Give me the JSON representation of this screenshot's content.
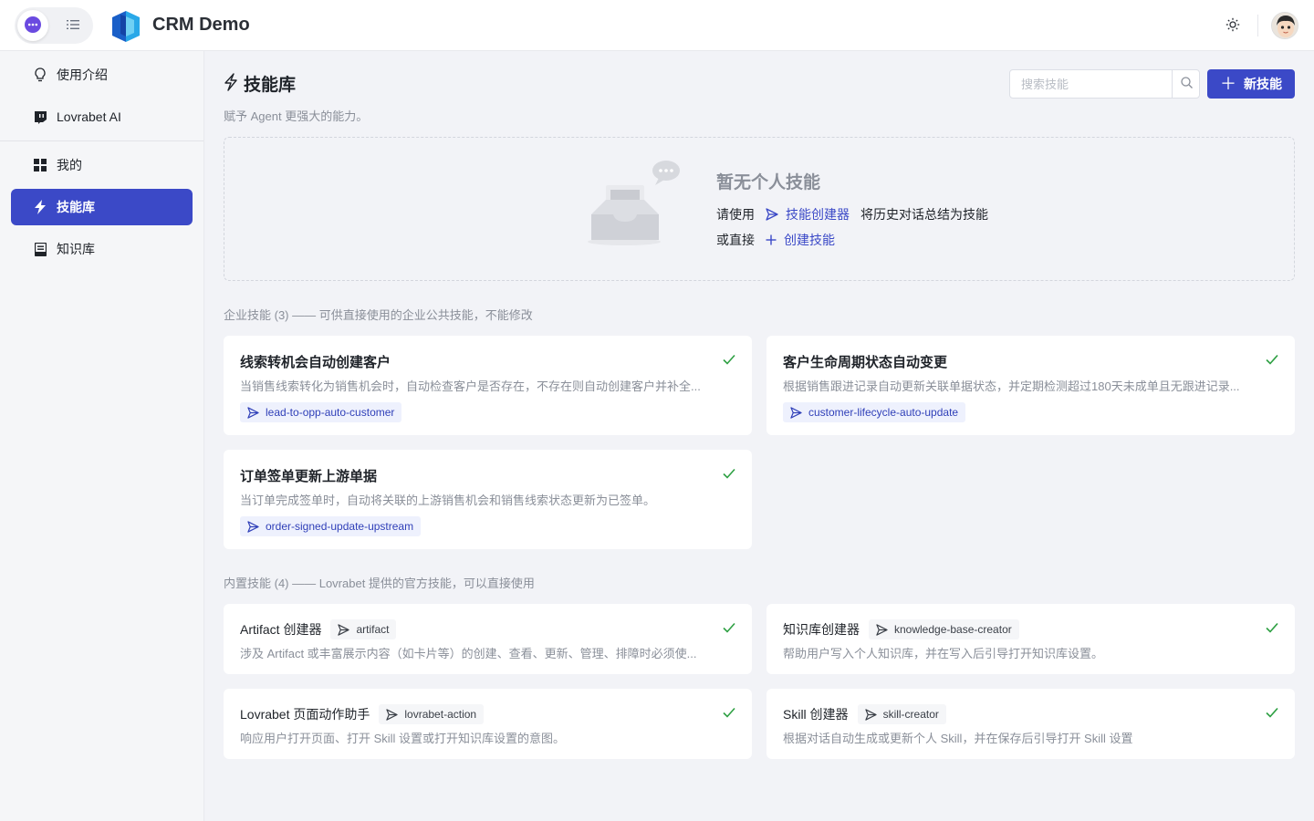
{
  "header": {
    "app_title": "CRM Demo",
    "icons": {
      "chat_toggle": "chat-bubble-icon",
      "list_toggle": "list-icon",
      "logo": "crm-logo-icon",
      "theme": "sun-icon",
      "avatar": "user-avatar"
    },
    "accent_color": "#3b49c7"
  },
  "sidebar": {
    "items": [
      {
        "label": "使用介绍",
        "icon": "lightbulb-icon"
      },
      {
        "label": "Lovrabet AI",
        "icon": "twitch-chat-icon"
      },
      {
        "label": "我的",
        "icon": "grid-icon"
      },
      {
        "label": "技能库",
        "icon": "bolt-icon",
        "active": true
      },
      {
        "label": "知识库",
        "icon": "book-icon"
      }
    ]
  },
  "main": {
    "title": "技能库",
    "subtitle": "赋予 Agent 更强大的能力。",
    "search": {
      "placeholder": "搜索技能"
    },
    "new_button": "新技能",
    "empty": {
      "title": "暂无个人技能",
      "line1_prefix": "请使用",
      "line1_link": "技能创建器",
      "line1_suffix": "将历史对话总结为技能",
      "line2_prefix": "或直接",
      "line2_link": "创建技能"
    },
    "enterprise_label": "企业技能 (3) —— 可供直接使用的企业公共技能，不能修改",
    "enterprise_skills": [
      {
        "title": "线索转机会自动创建客户",
        "desc": "当销售线索转化为销售机会时，自动检查客户是否存在，不存在则自动创建客户并补全...",
        "tag": "lead-to-opp-auto-customer"
      },
      {
        "title": "客户生命周期状态自动变更",
        "desc": "根据销售跟进记录自动更新关联单据状态，并定期检测超过180天未成单且无跟进记录...",
        "tag": "customer-lifecycle-auto-update"
      },
      {
        "title": "订单签单更新上游单据",
        "desc": "当订单完成签单时，自动将关联的上游销售机会和销售线索状态更新为已签单。",
        "tag": "order-signed-update-upstream"
      }
    ],
    "builtin_label": "内置技能 (4) —— Lovrabet 提供的官方技能，可以直接使用",
    "builtin_skills": [
      {
        "title": "Artifact 创建器",
        "tag": "artifact",
        "desc": "涉及 Artifact 或丰富展示内容（如卡片等）的创建、查看、更新、管理、排障时必须使..."
      },
      {
        "title": "知识库创建器",
        "tag": "knowledge-base-creator",
        "desc": "帮助用户写入个人知识库，并在写入后引导打开知识库设置。"
      },
      {
        "title": "Lovrabet 页面动作助手",
        "tag": "lovrabet-action",
        "desc": "响应用户打开页面、打开 Skill 设置或打开知识库设置的意图。"
      },
      {
        "title": "Skill 创建器",
        "tag": "skill-creator",
        "desc": "根据对话自动生成或更新个人 Skill，并在保存后引导打开 Skill 设置"
      }
    ],
    "status_color": "#2ea043"
  }
}
